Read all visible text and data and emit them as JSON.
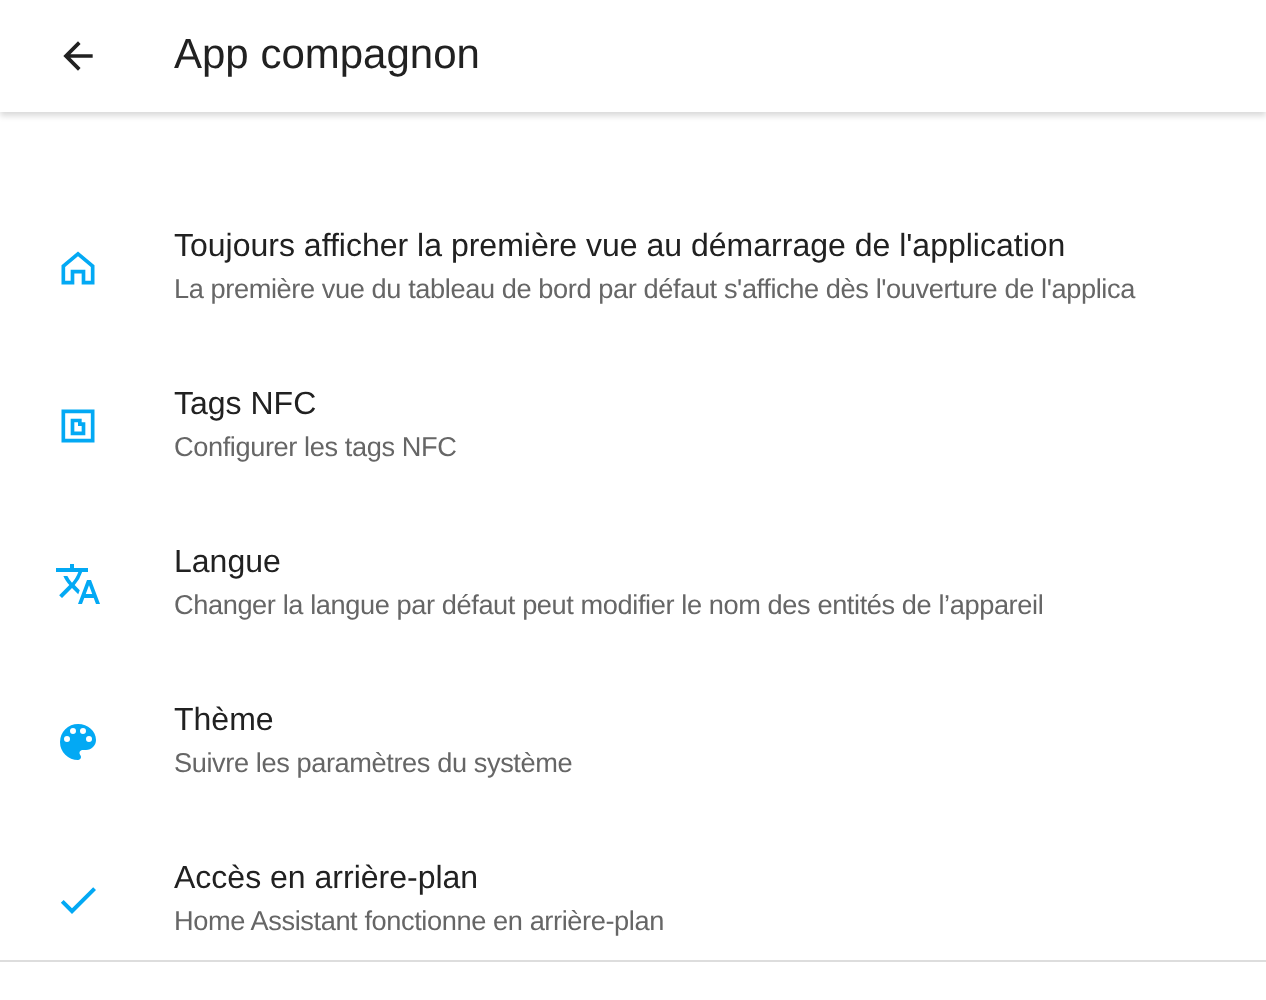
{
  "app_bar": {
    "title": "App compagnon"
  },
  "settings": [
    {
      "kind": "home",
      "title": "Toujours afficher la première vue au démarrage de l'application",
      "summary": "La première vue du tableau de bord par défaut s'affiche dès l'ouverture de l'applica"
    },
    {
      "kind": "nfc",
      "title": "Tags NFC",
      "summary": "Configurer les tags NFC"
    },
    {
      "kind": "language",
      "title": "Langue",
      "summary": "Changer la langue par défaut peut modifier le nom des entités de l’appareil"
    },
    {
      "kind": "palette",
      "title": "Thème",
      "summary": "Suivre les paramètres du système"
    },
    {
      "kind": "check",
      "title": "Accès en arrière-plan",
      "summary": "Home Assistant fonctionne en arrière-plan"
    }
  ]
}
